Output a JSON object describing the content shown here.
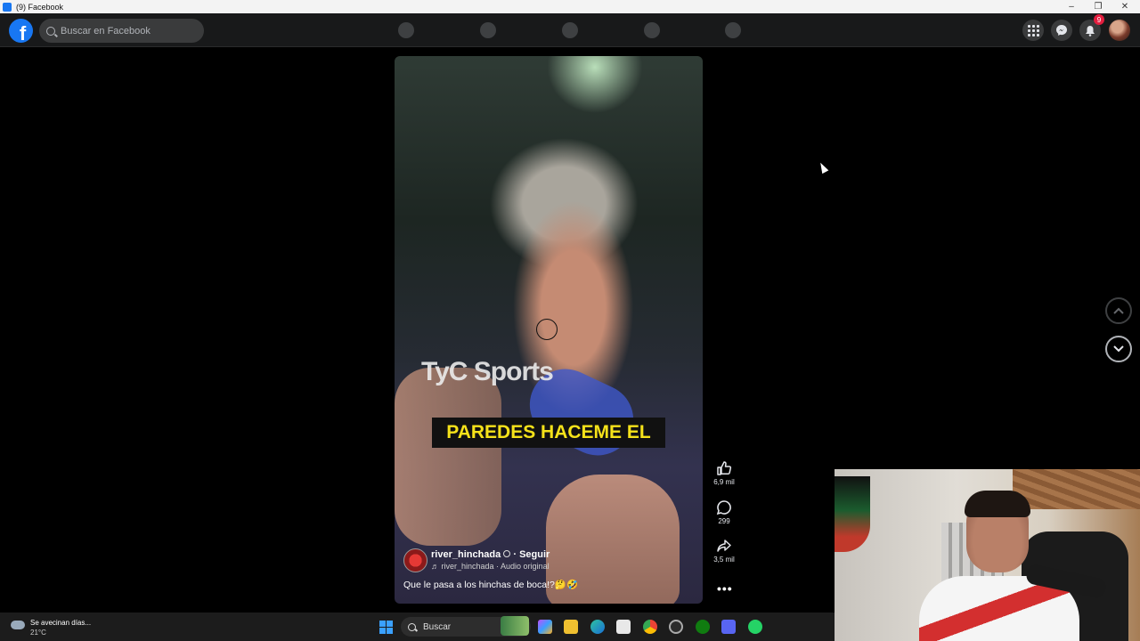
{
  "window": {
    "title": "(9) Facebook",
    "controls": [
      "–",
      "❐",
      "✕"
    ]
  },
  "header": {
    "logo": "f",
    "search": {
      "placeholder": "Buscar en Facebook"
    },
    "notifications_badge": "9"
  },
  "reel": {
    "watermark": "TyC Sports",
    "caption": "PAREDES HACEME EL",
    "channel": "river_hinchada",
    "follow": "Seguir",
    "audio": "♬ river_hinchada · Audio original",
    "description": "Que le pasa a los hinchas de boca!?🤔🤣"
  },
  "actions": {
    "likes": "6,9 mil",
    "comments": "299",
    "shares": "3,5 mil",
    "more": "•••"
  },
  "taskbar": {
    "weather_line1": "Se avecinan días...",
    "weather_line2": "21°C",
    "search_label": "Buscar"
  },
  "colors": {
    "fb_blue": "#1877f2",
    "caption_yellow": "#f5e21a",
    "badge_red": "#e41e3f"
  }
}
